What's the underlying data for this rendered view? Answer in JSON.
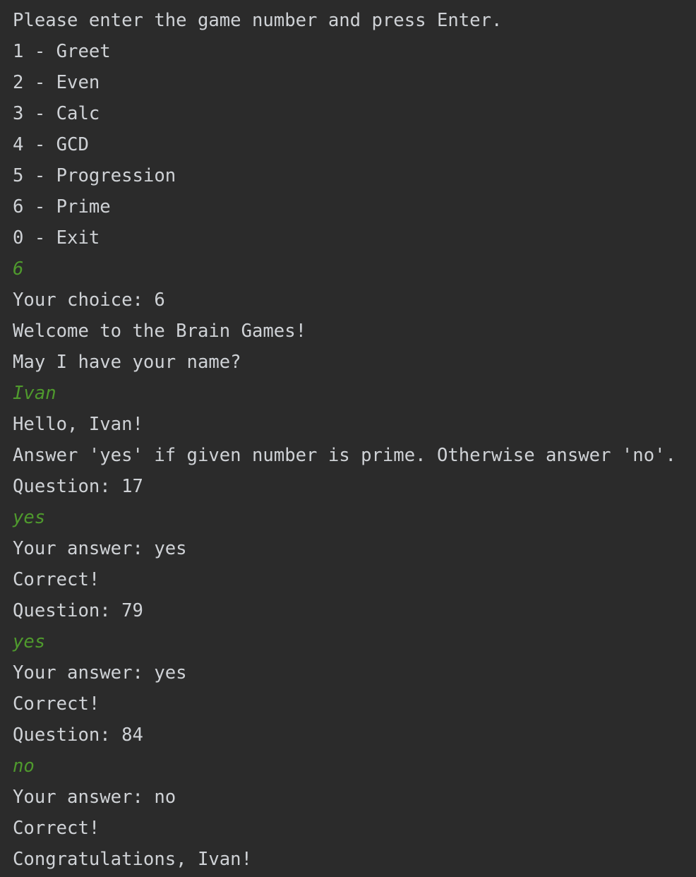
{
  "console": {
    "lines": [
      {
        "text": "Please enter the game number and press Enter.",
        "kind": "output"
      },
      {
        "text": "1 - Greet",
        "kind": "output"
      },
      {
        "text": "2 - Even",
        "kind": "output"
      },
      {
        "text": "3 - Calc",
        "kind": "output"
      },
      {
        "text": "4 - GCD",
        "kind": "output"
      },
      {
        "text": "5 - Progression",
        "kind": "output"
      },
      {
        "text": "6 - Prime",
        "kind": "output"
      },
      {
        "text": "0 - Exit",
        "kind": "output"
      },
      {
        "text": "6",
        "kind": "input"
      },
      {
        "text": "Your choice: 6",
        "kind": "output"
      },
      {
        "text": "Welcome to the Brain Games!",
        "kind": "output"
      },
      {
        "text": "May I have your name?",
        "kind": "output"
      },
      {
        "text": "Ivan",
        "kind": "input"
      },
      {
        "text": "Hello, Ivan!",
        "kind": "output"
      },
      {
        "text": "Answer 'yes' if given number is prime. Otherwise answer 'no'.",
        "kind": "output"
      },
      {
        "text": "Question: 17",
        "kind": "output"
      },
      {
        "text": "yes",
        "kind": "input"
      },
      {
        "text": "Your answer: yes",
        "kind": "output"
      },
      {
        "text": "Correct!",
        "kind": "output"
      },
      {
        "text": "Question: 79",
        "kind": "output"
      },
      {
        "text": "yes",
        "kind": "input"
      },
      {
        "text": "Your answer: yes",
        "kind": "output"
      },
      {
        "text": "Correct!",
        "kind": "output"
      },
      {
        "text": "Question: 84",
        "kind": "output"
      },
      {
        "text": "no",
        "kind": "input"
      },
      {
        "text": "Your answer: no",
        "kind": "output"
      },
      {
        "text": "Correct!",
        "kind": "output"
      },
      {
        "text": "Congratulations, Ivan!",
        "kind": "output"
      }
    ]
  },
  "colors": {
    "background": "#2b2b2b",
    "output_text": "#cfd2d6",
    "user_input_text": "#4f9a2d"
  }
}
